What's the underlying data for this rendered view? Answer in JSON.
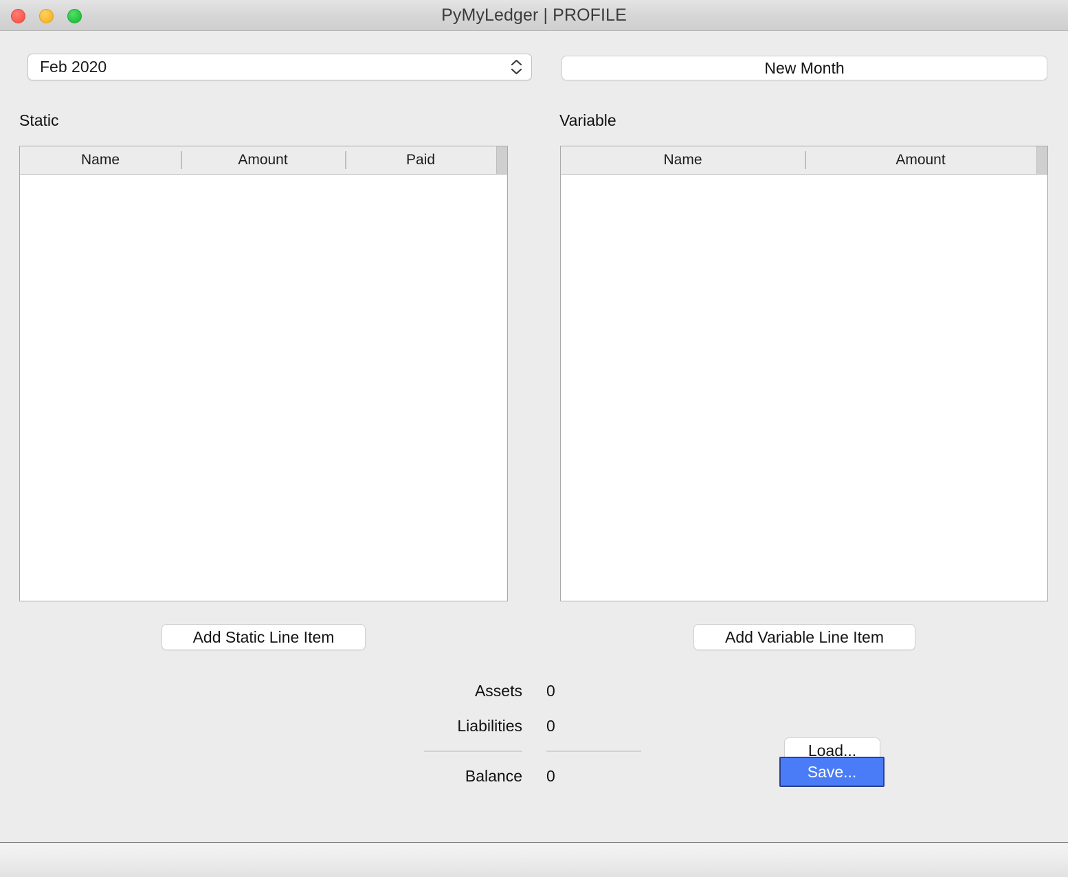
{
  "window": {
    "title": "PyMyLedger | PROFILE",
    "traffic_lights": [
      {
        "name": "close",
        "color": "#FF5F57"
      },
      {
        "name": "minimize",
        "color": "#FEBC2E"
      },
      {
        "name": "maximize",
        "color": "#28C840"
      }
    ]
  },
  "toolbar": {
    "month_select_value": "Feb 2020",
    "new_month_label": "New Month"
  },
  "static_section": {
    "label": "Static",
    "columns": [
      "Name",
      "Amount",
      "Paid"
    ],
    "rows": [],
    "add_label": "Add Static Line Item"
  },
  "variable_section": {
    "label": "Variable",
    "columns": [
      "Name",
      "Amount"
    ],
    "rows": [],
    "add_label": "Add Variable Line Item"
  },
  "summary": {
    "assets_label": "Assets",
    "assets_value": "0",
    "liabilities_label": "Liabilities",
    "liabilities_value": "0",
    "balance_label": "Balance",
    "balance_value": "0"
  },
  "actions": {
    "load_label": "Load...",
    "save_label": "Save...",
    "save_accent_color": "#4A7CF7"
  }
}
